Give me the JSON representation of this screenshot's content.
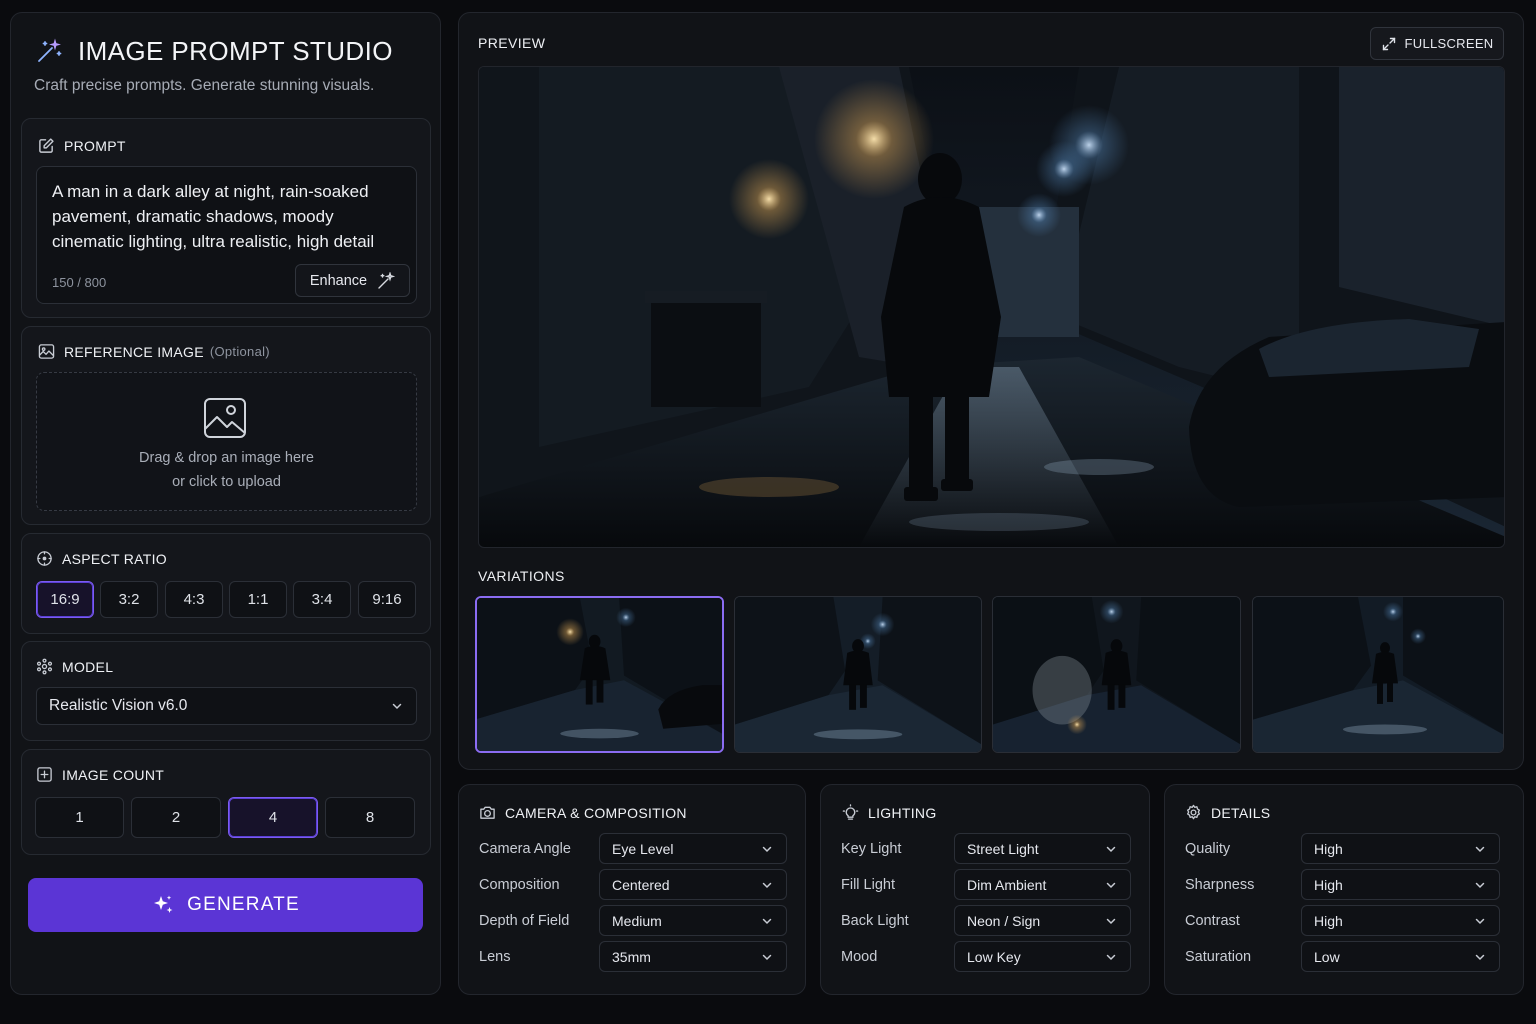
{
  "app": {
    "title": "IMAGE PROMPT STUDIO",
    "subtitle": "Craft precise prompts. Generate stunning visuals."
  },
  "prompt": {
    "heading": "PROMPT",
    "text_lines": [
      "A man in a dark alley at night, rain-soaked",
      "pavement, dramatic shadows, moody",
      "cinematic lighting, ultra realistic, high detail"
    ],
    "counter": "150 / 800",
    "enhance_label": "Enhance"
  },
  "reference": {
    "heading": "REFERENCE IMAGE",
    "optional": "(Optional)",
    "drop_line1": "Drag & drop an image here",
    "drop_line2": "or click to upload"
  },
  "aspect": {
    "heading": "ASPECT RATIO",
    "options": [
      "16:9",
      "3:2",
      "4:3",
      "1:1",
      "3:4",
      "9:16"
    ],
    "selected": "16:9"
  },
  "model": {
    "heading": "MODEL",
    "value": "Realistic Vision v6.0"
  },
  "count": {
    "heading": "IMAGE COUNT",
    "options": [
      "1",
      "2",
      "4",
      "8"
    ],
    "selected": "4"
  },
  "generate_label": "GENERATE",
  "preview": {
    "heading": "PREVIEW",
    "fullscreen_label": "FULLSCREEN"
  },
  "variations": {
    "heading": "VARIATIONS",
    "selected_index": 0
  },
  "camera": {
    "heading": "CAMERA & COMPOSITION",
    "rows": [
      {
        "label": "Camera Angle",
        "value": "Eye Level"
      },
      {
        "label": "Composition",
        "value": "Centered"
      },
      {
        "label": "Depth of Field",
        "value": "Medium"
      },
      {
        "label": "Lens",
        "value": "35mm"
      }
    ]
  },
  "lighting": {
    "heading": "LIGHTING",
    "rows": [
      {
        "label": "Key Light",
        "value": "Street Light"
      },
      {
        "label": "Fill Light",
        "value": "Dim Ambient"
      },
      {
        "label": "Back Light",
        "value": "Neon / Sign"
      },
      {
        "label": "Mood",
        "value": "Low Key"
      }
    ]
  },
  "details": {
    "heading": "DETAILS",
    "rows": [
      {
        "label": "Quality",
        "value": "High"
      },
      {
        "label": "Sharpness",
        "value": "High"
      },
      {
        "label": "Contrast",
        "value": "High"
      },
      {
        "label": "Saturation",
        "value": "Low"
      }
    ]
  },
  "colors": {
    "accent": "#5b35d5",
    "accent_border": "#7c5cf0",
    "background": "#0a0b0e"
  }
}
